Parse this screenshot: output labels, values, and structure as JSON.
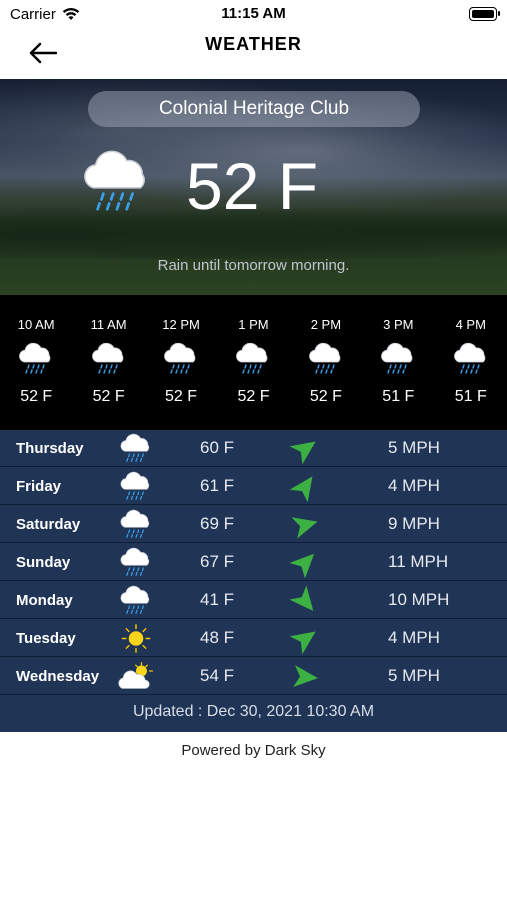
{
  "status_bar": {
    "carrier": "Carrier",
    "time": "11:15 AM"
  },
  "header": {
    "title": "WEATHER",
    "back_icon": "arrow-left-icon"
  },
  "current": {
    "location": "Colonial Heritage Club",
    "temperature": "52 F",
    "icon": "rain-cloud-icon",
    "summary": "Rain until tomorrow morning."
  },
  "hourly": [
    {
      "time": "10 AM",
      "temp": "52 F",
      "icon": "rain-cloud-icon"
    },
    {
      "time": "11 AM",
      "temp": "52 F",
      "icon": "rain-cloud-icon"
    },
    {
      "time": "12 PM",
      "temp": "52 F",
      "icon": "rain-cloud-icon"
    },
    {
      "time": "1 PM",
      "temp": "52 F",
      "icon": "rain-cloud-icon"
    },
    {
      "time": "2 PM",
      "temp": "52 F",
      "icon": "rain-cloud-icon"
    },
    {
      "time": "3 PM",
      "temp": "51 F",
      "icon": "rain-cloud-icon"
    },
    {
      "time": "4 PM",
      "temp": "51 F",
      "icon": "rain-cloud-icon"
    }
  ],
  "daily": [
    {
      "day": "Thursday",
      "temp": "60 F",
      "wind": "5 MPH",
      "icon": "rain-cloud-icon",
      "wind_icon": "wind-direction-arrow-icon"
    },
    {
      "day": "Friday",
      "temp": "61 F",
      "wind": "4 MPH",
      "icon": "rain-cloud-icon",
      "wind_icon": "wind-direction-arrow-icon"
    },
    {
      "day": "Saturday",
      "temp": "69 F",
      "wind": "9 MPH",
      "icon": "rain-cloud-icon",
      "wind_icon": "wind-direction-arrow-icon"
    },
    {
      "day": "Sunday",
      "temp": "67 F",
      "wind": "11 MPH",
      "icon": "rain-cloud-icon",
      "wind_icon": "wind-direction-arrow-icon"
    },
    {
      "day": "Monday",
      "temp": "41 F",
      "wind": "10 MPH",
      "icon": "rain-cloud-icon",
      "wind_icon": "wind-direction-arrow-icon"
    },
    {
      "day": "Tuesday",
      "temp": "48 F",
      "wind": "4 MPH",
      "icon": "sun-icon",
      "wind_icon": "wind-direction-arrow-icon"
    },
    {
      "day": "Wednesday",
      "temp": "54 F",
      "wind": "5 MPH",
      "icon": "partly-cloudy-icon",
      "wind_icon": "wind-direction-arrow-icon"
    }
  ],
  "updated": "Updated : Dec 30, 2021 10:30 AM",
  "footer": {
    "powered_by": "Powered by Dark Sky"
  },
  "colors": {
    "daily_bg": "#203456",
    "hourly_bg": "#000000",
    "wind_arrow": "#3cb043",
    "sun": "#f7d417"
  }
}
